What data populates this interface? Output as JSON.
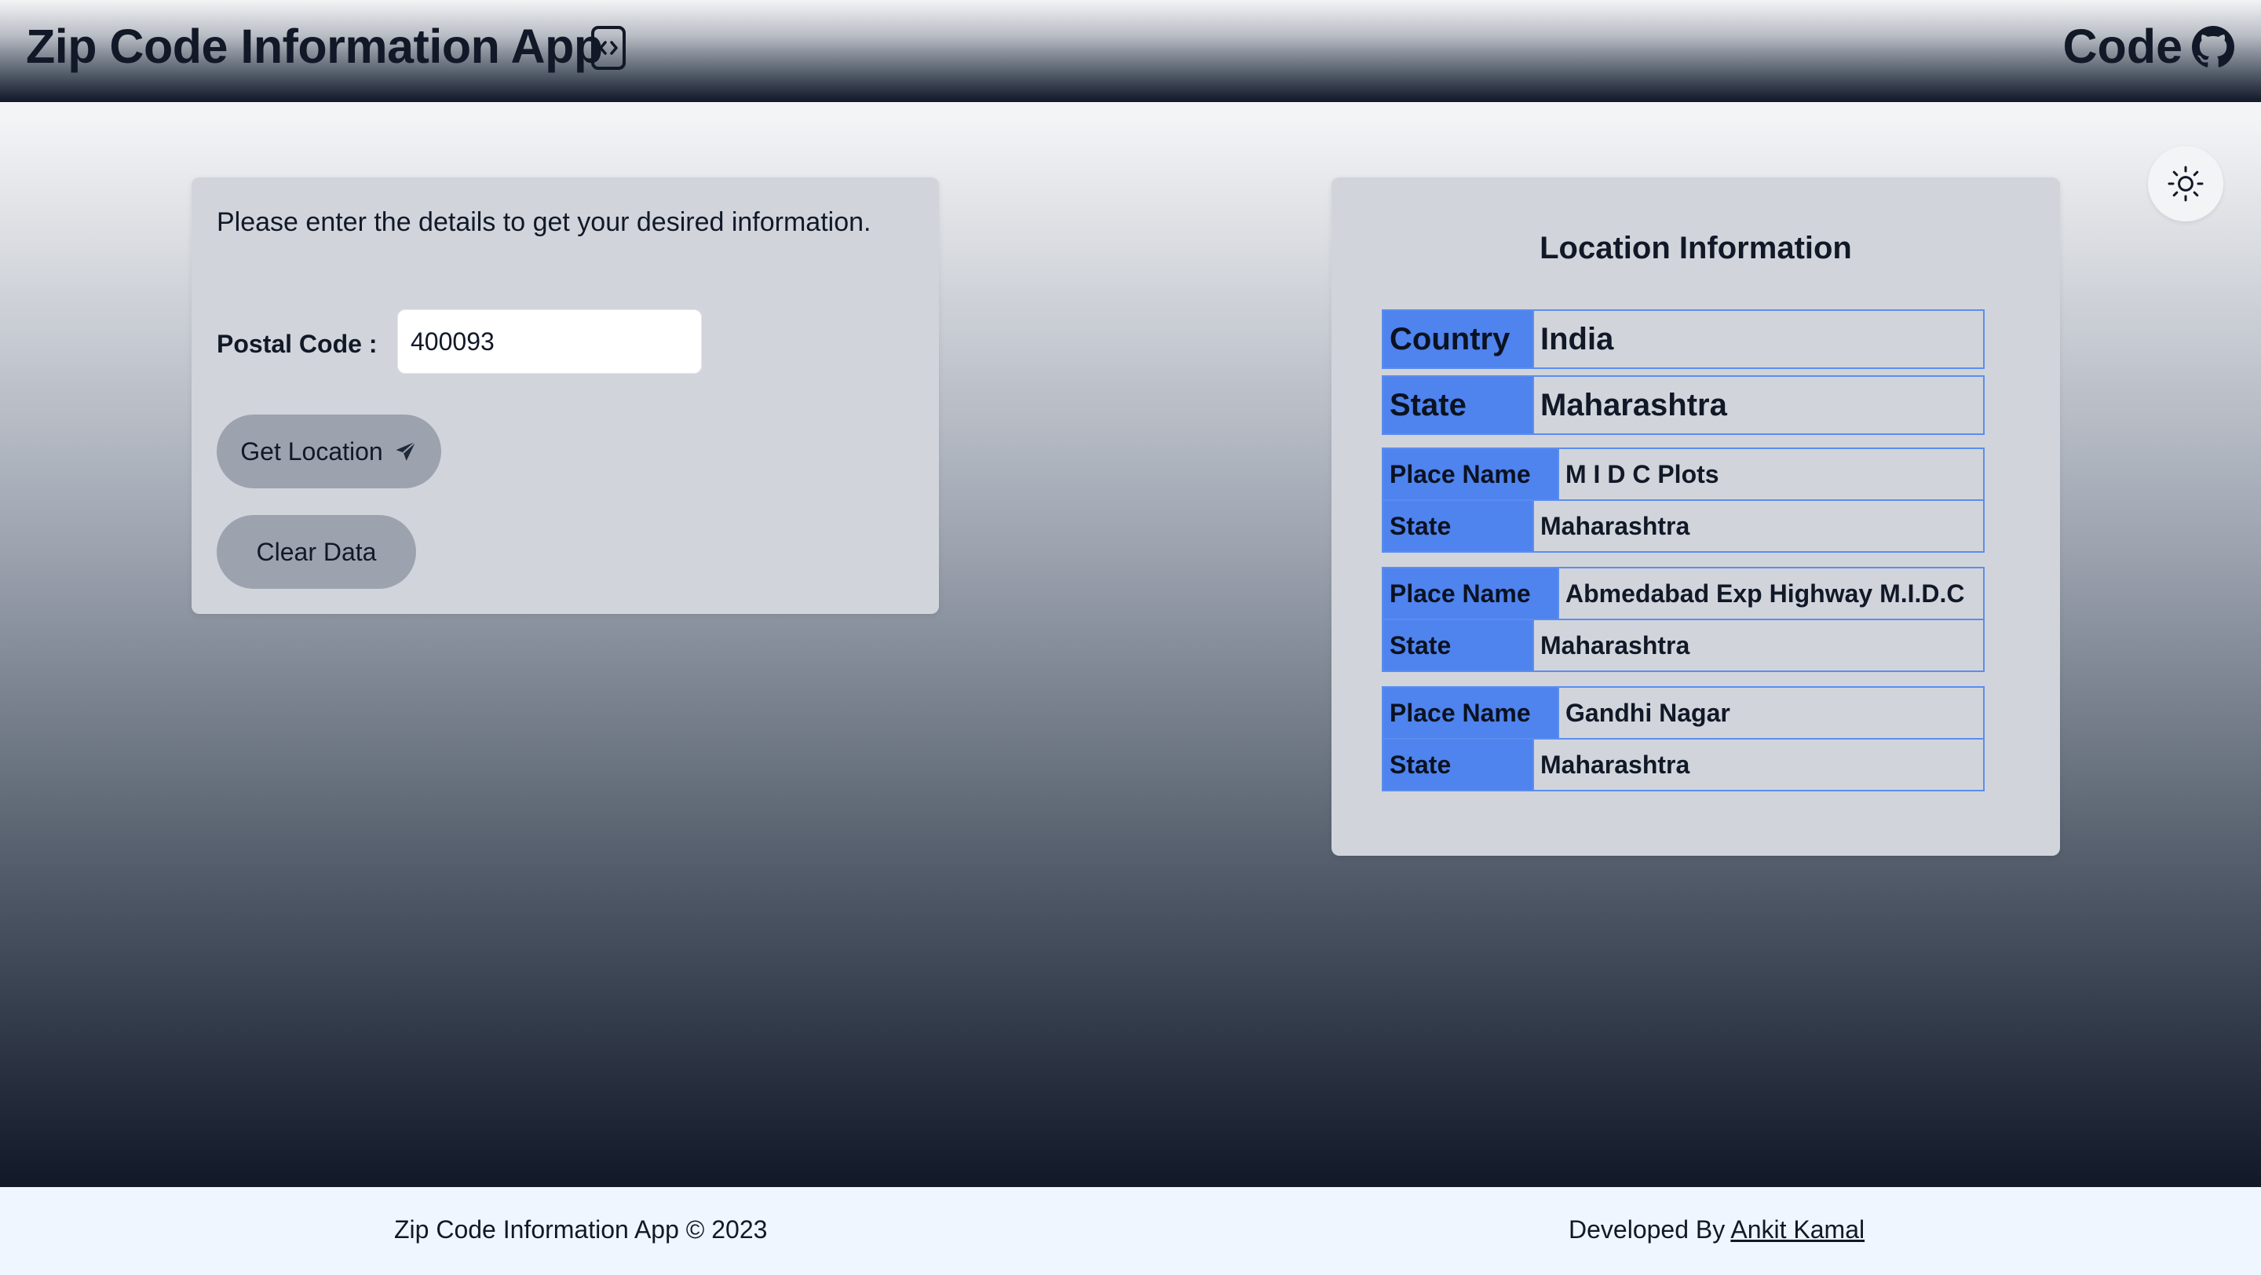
{
  "header": {
    "title": "Zip Code Information App",
    "code_link": "Code"
  },
  "icons": {
    "app_icon": "code-brackets-icon",
    "code_link_icon": "github-icon",
    "theme_toggle": "sun-icon",
    "get_location": "paper-plane-icon"
  },
  "form": {
    "intro": "Please enter the details to get your desired information.",
    "postal_label": "Postal Code :",
    "postal_value": "400093",
    "get_location_label": "Get Location",
    "clear_label": "Clear Data"
  },
  "location": {
    "title": "Location Information",
    "country_label": "Country",
    "country": "India",
    "state_label": "State",
    "state": "Maharashtra",
    "place_name_label": "Place Name",
    "places": [
      {
        "name": "M I D C Plots",
        "state": "Maharashtra"
      },
      {
        "name": "Abmedabad Exp Highway M.I.D.C",
        "state": "Maharashtra"
      },
      {
        "name": "Gandhi Nagar",
        "state": "Maharashtra"
      }
    ]
  },
  "footer": {
    "left": "Zip Code Information App © 2023",
    "developed_by": "Developed By",
    "developer": "Ankit Kamal"
  },
  "colors": {
    "key_cell": "#4f83ee",
    "card": "#d1d5db",
    "footer": "#eff6ff"
  }
}
